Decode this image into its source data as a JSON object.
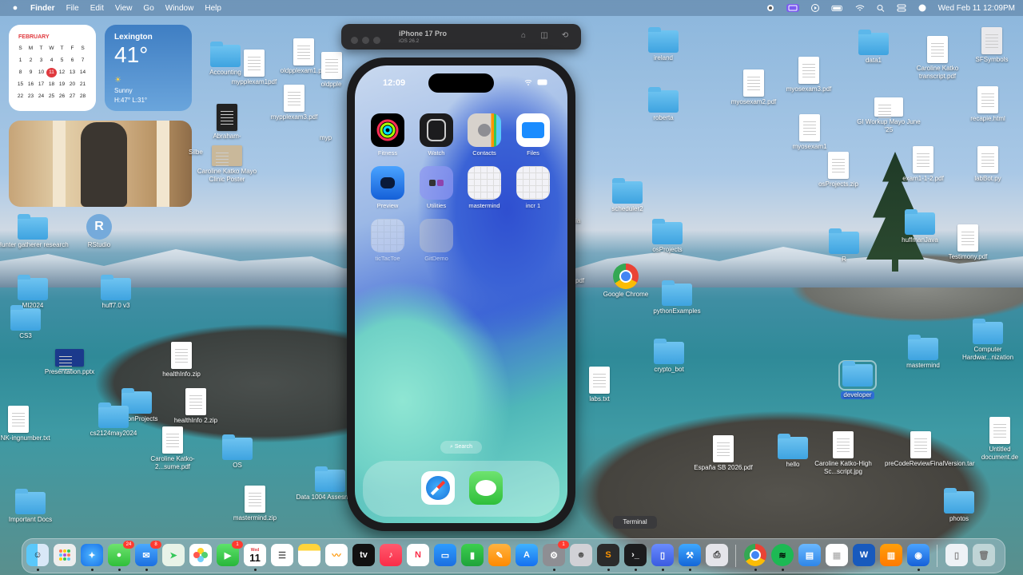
{
  "menubar": {
    "app_name": "Finder",
    "items": [
      "File",
      "Edit",
      "View",
      "Go",
      "Window",
      "Help"
    ],
    "clock": "Wed Feb 11  12:09PM"
  },
  "widgets": {
    "calendar": {
      "month": "FEBRUARY",
      "weekdays": [
        "S",
        "M",
        "T",
        "W",
        "T",
        "F",
        "S"
      ],
      "days": [
        "1",
        "2",
        "3",
        "4",
        "5",
        "6",
        "7",
        "8",
        "9",
        "10",
        "11",
        "12",
        "13",
        "14",
        "15",
        "16",
        "17",
        "18",
        "19",
        "20",
        "21",
        "22",
        "23",
        "24",
        "25",
        "26",
        "27",
        "28"
      ],
      "today": "11"
    },
    "weather": {
      "city": "Lexington",
      "temp": "41°",
      "condition": "Sunny",
      "hilo": "H:47° L:31°"
    }
  },
  "desktop": {
    "accounting": "Accounting",
    "mypplexam1": "mypplexam1pdf",
    "oldpplexam1": "oldpplexam1.pdf",
    "oldpple": "oldpple",
    "mypplexam3": "mypplexam3.pdf",
    "mypp_cut": "myp",
    "abraham": "Abraham-",
    "silbe": "Silbe",
    "silbe_end": "8.pdf",
    "caroline_poster": "Caroline Katko Mayo Clinic Poster",
    "hunter": "Hunter gatherer research",
    "rstudio": "RStudio",
    "mi2024": "MI2024",
    "huff": "huff7.0 v3",
    "cs3": "CS3",
    "presentation": "Presentation.pptx",
    "healthinfo": "healthInfo.zip",
    "pythonprojects": "pythonProjects",
    "healthinfo2": "healthInfo 2.zip",
    "mylink": "MyLINK-ingnumber.txt",
    "cs2124": "cs2124may2024",
    "caroline_resume": "Caroline Katko-2...sume.pdf",
    "os": "OS",
    "important": "Important Docs",
    "mastermind_zip": "mastermind.zip",
    "data1004": "Data 1004 Assesment 1",
    "ireland": "ireland",
    "roberta": "roberta",
    "scheduler2": "scheduler2",
    "ia_cut": "ia",
    "osprojects": "osProjects",
    "pdf_cut": "pdf",
    "chrome": "Google Chrome",
    "pythonexamples": "pythonExamples",
    "crypto": "crypto_bot",
    "labs": "labs.txt",
    "espana": "España SB 2026.pdf",
    "myosexam2": "myosexam2.pdf",
    "myosexam3": "myosexam3.pdf",
    "myosexam1": "myosexam1",
    "osprojects_zip": "osProjects.zip",
    "data1": "data1",
    "gi_workup": "GI Workup Mayo June '25",
    "exam1": "exam1-1-2.pdf",
    "r": "R",
    "huffmanjava": "huffmanJava",
    "testimony": "Testimony.pdf",
    "transcript": "Caroline Katko transcript.pdf",
    "cnet": "cnet",
    "sfsymbols": "SFSymbols",
    "recapie": "recapie.html",
    "labbot": "labBot.py",
    "computer_hw": "Computer Hardwar...nization",
    "mastermind": "mastermind",
    "developer": "developer",
    "hello": "hello",
    "highschool": "Caroline Katko-High Sc...script.jpg",
    "precode": "preCodeReviewFinalVersion.tar",
    "untitled": "Untitled document.de",
    "photos": "photos"
  },
  "simulator": {
    "device": "iPhone 17 Pro",
    "os": "iOS 26.2",
    "time": "12:09",
    "apps": [
      "Fitness",
      "Watch",
      "Contacts",
      "Files",
      "Preview",
      "Utilities",
      "mastermind",
      "incr 1",
      "ticTacToe",
      "GitDemo"
    ],
    "search": "Search"
  },
  "tooltip": "Terminal",
  "dock": {
    "badges": {
      "messages": "24",
      "mail": "8",
      "facetime": "1",
      "settings": "1"
    },
    "calendar_month": "Wed",
    "calendar_day": "11"
  }
}
